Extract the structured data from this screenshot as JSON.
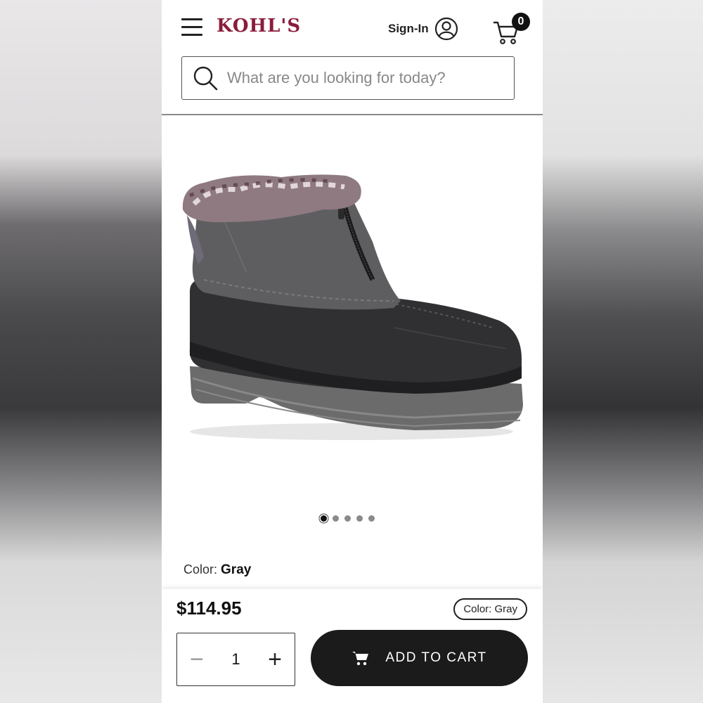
{
  "header": {
    "logo_text": "KOHL'S",
    "signin_label": "Sign-In",
    "cart_count": "0"
  },
  "search": {
    "placeholder": "What are you looking for today?"
  },
  "gallery": {
    "image_count": 5,
    "active_index": 0
  },
  "product": {
    "color_label": "Color:",
    "color_value": "Gray"
  },
  "bottom_bar": {
    "price": "$114.95",
    "color_pill": "Color: Gray",
    "quantity": "1",
    "add_to_cart_label": "ADD TO CART"
  },
  "icons": [
    "hamburger-menu-icon",
    "user-account-icon",
    "cart-icon",
    "search-icon",
    "minus-icon",
    "plus-icon"
  ],
  "colors": {
    "brand": "#8b1c3c",
    "button": "#1b1b1b"
  }
}
